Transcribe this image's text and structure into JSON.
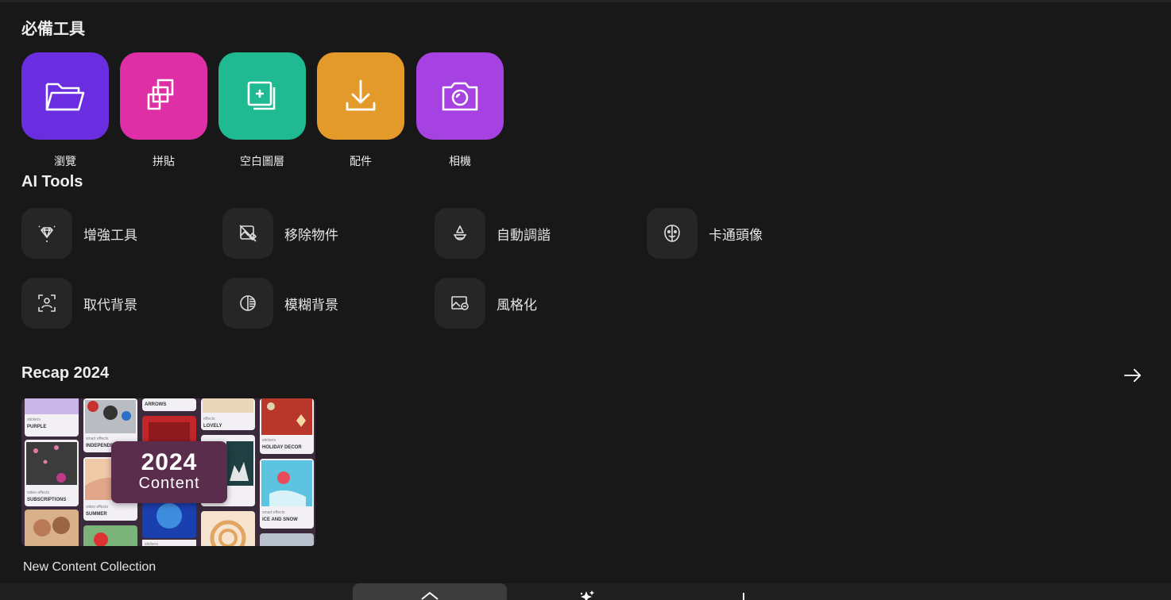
{
  "essentials": {
    "title": "必備工具",
    "tools": [
      {
        "label": "瀏覽",
        "icon": "folder-icon",
        "color": "#6a2ee0"
      },
      {
        "label": "拼貼",
        "icon": "collage-icon",
        "color": "#de2fa6"
      },
      {
        "label": "空白圖層",
        "icon": "add-layer-icon",
        "color": "#1fb992"
      },
      {
        "label": "配件",
        "icon": "download-icon",
        "color": "#e49a2a"
      },
      {
        "label": "相機",
        "icon": "camera-icon",
        "color": "#a742e2"
      }
    ]
  },
  "ai_tools": {
    "title": "AI Tools",
    "tools": [
      {
        "label": "增強工具",
        "icon": "diamond-sparkle-icon"
      },
      {
        "label": "移除物件",
        "icon": "remove-object-icon"
      },
      {
        "label": "自動調諧",
        "icon": "auto-tune-icon"
      },
      {
        "label": "卡通頭像",
        "icon": "cartoon-face-icon"
      },
      {
        "label": "取代背景",
        "icon": "replace-background-icon"
      },
      {
        "label": "模糊背景",
        "icon": "blur-background-icon"
      },
      {
        "label": "風格化",
        "icon": "stylize-image-icon"
      }
    ]
  },
  "recap": {
    "title": "Recap 2024",
    "arrow_icon": "arrow-right-icon",
    "card": {
      "badge_year": "2024",
      "badge_content": "Content",
      "caption": "New Content Collection",
      "tiles": [
        {
          "category": "stickers",
          "name": "PURPLE"
        },
        {
          "category": "smart effects",
          "name": "INDEPENDE"
        },
        {
          "category": "",
          "name": "ARROWS"
        },
        {
          "category": "effects",
          "name": "LOVELY"
        },
        {
          "category": "stickers",
          "name": "HOLIDAY DECOR"
        },
        {
          "category": "video effects",
          "name": "SUBSCRIPTIONS"
        },
        {
          "category": "video effects",
          "name": "SUMMER"
        },
        {
          "category": "smart effects",
          "name": "ICE AND SNOW"
        },
        {
          "category": "stickers",
          "name": ""
        }
      ]
    }
  },
  "bottom_nav": {
    "items": [
      {
        "name": "home",
        "icon": "home-icon",
        "active": true
      },
      {
        "name": "ai",
        "icon": "sparkle-icon"
      },
      {
        "name": "add",
        "icon": "plus-icon"
      }
    ]
  }
}
